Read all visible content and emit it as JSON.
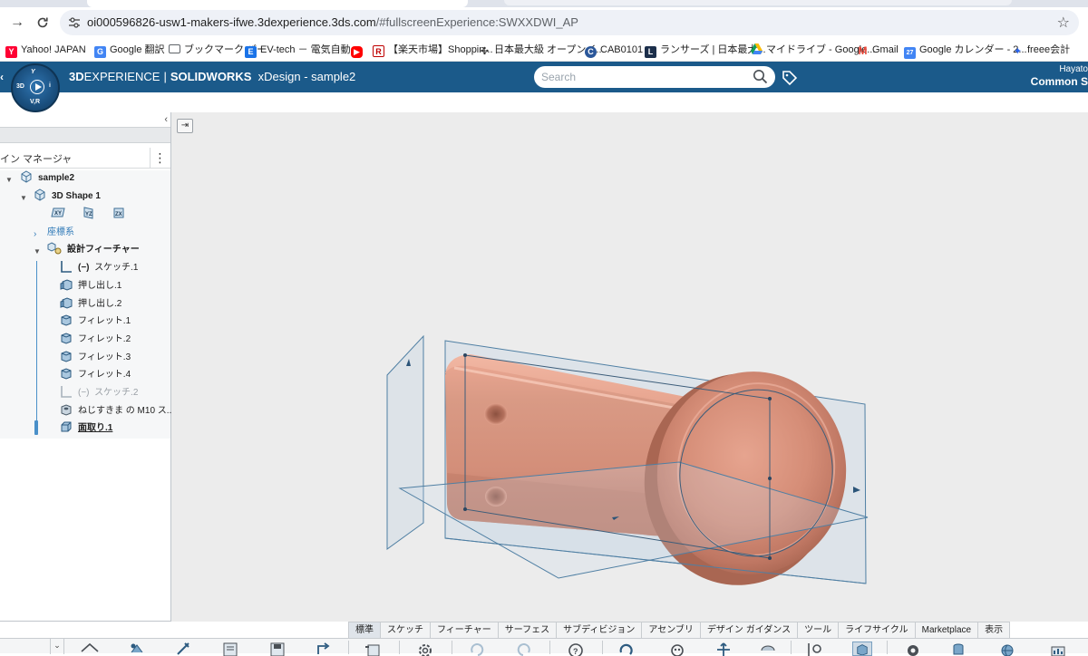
{
  "browser": {
    "url_host": "oi000596826-usw1-makers-ifwe.3dexperience.3ds.com",
    "url_path": "/#fullscreenExperience:SWXXDWI_AP",
    "bookmarks": [
      {
        "label": "Yahoo! JAPAN",
        "icon": "yahoo-icon",
        "color": "#ff0033"
      },
      {
        "label": "Google 翻訳",
        "icon": "google-translate-icon",
        "color": "#4285f4"
      },
      {
        "label": "ブックマーク バー",
        "icon": "folder-icon",
        "color": "#5f6368"
      },
      {
        "label": "EV-tech － 電気自動...",
        "icon": "evtech-icon",
        "color": "#1a73e8"
      },
      {
        "label": "",
        "icon": "youtube-icon",
        "color": "#ff0000"
      },
      {
        "label": "【楽天市場】Shoppin...",
        "icon": "rakuten-icon",
        "color": "#bf0000"
      },
      {
        "label": "日本最大級 オープンイ...",
        "icon": "arrows-icon",
        "color": "#333333"
      },
      {
        "label": "CAB0101",
        "icon": "cab-icon",
        "color": "#2b579a"
      },
      {
        "label": "ランサーズ | 日本最大...",
        "icon": "lancers-icon",
        "color": "#1c2f4b"
      },
      {
        "label": "マイドライブ - Google...",
        "icon": "drive-icon",
        "color": "#0f9d58"
      },
      {
        "label": "Gmail",
        "icon": "gmail-icon",
        "color": "#ea4335"
      },
      {
        "label": "Google カレンダー - 2...",
        "icon": "calendar-icon",
        "color": "#4285f4"
      },
      {
        "label": "freee会計",
        "icon": "freee-icon",
        "color": "#2864f0"
      }
    ]
  },
  "app": {
    "brand_bold": "3D",
    "brand_rest": "EXPERIENCE",
    "separator": "|",
    "product": "SOLIDWORKS",
    "title": "xDesign - sample2",
    "search_placeholder": "Search",
    "user_name": "Hayato",
    "org": "Common S",
    "compass_3d": "3D",
    "compass_vr": "V,R"
  },
  "panel": {
    "collapse_glyph": "‹",
    "header_title": "イン マネージャ",
    "kebab": "⋮",
    "tree": [
      {
        "label": "sample2",
        "bold": true,
        "icon": "product-icon"
      },
      {
        "label": "3D Shape 1",
        "bold": true,
        "icon": "part-icon"
      },
      {
        "label": "XY",
        "icon": "xy-plane-icon"
      },
      {
        "label": "YZ",
        "icon": "yz-plane-icon"
      },
      {
        "label": "ZX",
        "icon": "zx-plane-icon"
      },
      {
        "label": "座標系",
        "icon": ""
      },
      {
        "label": "設計フィーチャー",
        "bold": true,
        "icon": "features-icon"
      },
      {
        "label": "スケッチ.1",
        "prefix": "(−)",
        "icon": "sketch-icon"
      },
      {
        "label": "押し出し.1",
        "icon": "extrude-icon"
      },
      {
        "label": "押し出し.2",
        "icon": "extrude-icon"
      },
      {
        "label": "フィレット.1",
        "icon": "fillet-icon"
      },
      {
        "label": "フィレット.2",
        "icon": "fillet-icon"
      },
      {
        "label": "フィレット.3",
        "icon": "fillet-icon"
      },
      {
        "label": "フィレット.4",
        "icon": "fillet-icon"
      },
      {
        "label": "スケッチ.2",
        "prefix": "(−)",
        "icon": "sketch-icon",
        "dim": true
      },
      {
        "label": "ねじすきま の M10 ス...",
        "icon": "hole-icon"
      },
      {
        "label": "面取り.1",
        "bold": true,
        "underline": true,
        "icon": "chamfer-icon"
      }
    ]
  },
  "action_bar": {
    "tabs": [
      "標準",
      "スケッチ",
      "フィーチャー",
      "サーフェス",
      "サブディビジョン",
      "アセンブリ",
      "デザイン ガイダンス",
      "ツール",
      "ライフサイクル",
      "Marketplace",
      "表示"
    ],
    "active_tab": "標準",
    "expand_glyph": "⌄"
  },
  "colors": {
    "app_bar": "#1b5a8a",
    "model": "#d58d77",
    "plane_stroke": "#4f7fa3",
    "tree_line": "#4a90c9"
  }
}
